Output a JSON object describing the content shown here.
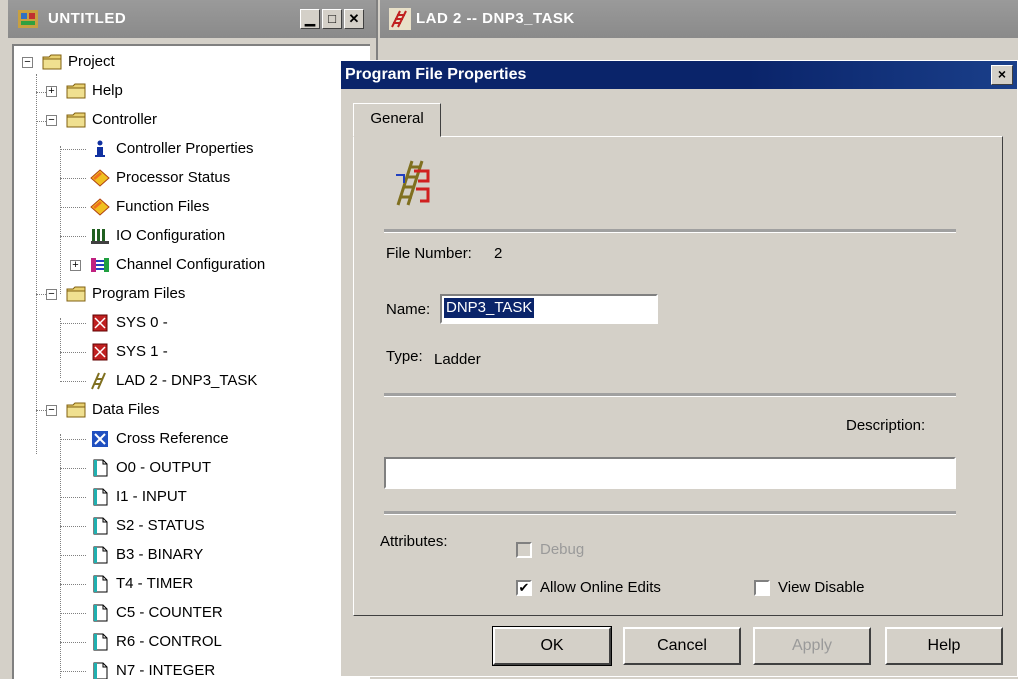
{
  "project_window": {
    "title": "UNTITLED",
    "tree": [
      {
        "key": "project",
        "label": "Project",
        "icon": "folder-icon",
        "level": 0,
        "expander": "minus"
      },
      {
        "key": "help",
        "label": "Help",
        "icon": "folder-icon",
        "level": 1,
        "expander": "plus"
      },
      {
        "key": "controller",
        "label": "Controller",
        "icon": "folder-icon",
        "level": 1,
        "expander": "minus"
      },
      {
        "key": "controller-properties",
        "label": "Controller Properties",
        "icon": "info-icon",
        "level": 2
      },
      {
        "key": "processor-status",
        "label": "Processor Status",
        "icon": "diamond-icon",
        "level": 2
      },
      {
        "key": "function-files",
        "label": "Function Files",
        "icon": "diamond-icon",
        "level": 2
      },
      {
        "key": "io-configuration",
        "label": "IO Configuration",
        "icon": "io-config-icon",
        "level": 2
      },
      {
        "key": "channel-configuration",
        "label": "Channel Configuration",
        "icon": "channel-icon",
        "level": 2,
        "expander": "plus"
      },
      {
        "key": "program-files",
        "label": "Program Files",
        "icon": "folder-icon",
        "level": 1,
        "expander": "minus"
      },
      {
        "key": "sys0",
        "label": "SYS 0 -",
        "icon": "sys-file-icon",
        "level": 2
      },
      {
        "key": "sys1",
        "label": "SYS 1 -",
        "icon": "sys-file-icon",
        "level": 2
      },
      {
        "key": "lad2",
        "label": "LAD 2 - DNP3_TASK",
        "icon": "ladder-icon",
        "level": 2
      },
      {
        "key": "data-files",
        "label": "Data Files",
        "icon": "folder-icon",
        "level": 1,
        "expander": "minus"
      },
      {
        "key": "cross-reference",
        "label": "Cross Reference",
        "icon": "cross-ref-icon",
        "level": 2
      },
      {
        "key": "o0",
        "label": "O0 - OUTPUT",
        "icon": "data-file-icon",
        "level": 2
      },
      {
        "key": "i1",
        "label": "I1 - INPUT",
        "icon": "data-file-icon",
        "level": 2
      },
      {
        "key": "s2",
        "label": "S2 - STATUS",
        "icon": "data-file-icon",
        "level": 2
      },
      {
        "key": "b3",
        "label": "B3 - BINARY",
        "icon": "data-file-icon",
        "level": 2
      },
      {
        "key": "t4",
        "label": "T4 - TIMER",
        "icon": "data-file-icon",
        "level": 2
      },
      {
        "key": "c5",
        "label": "C5 - COUNTER",
        "icon": "data-file-icon",
        "level": 2
      },
      {
        "key": "r6",
        "label": "R6 - CONTROL",
        "icon": "data-file-icon",
        "level": 2
      },
      {
        "key": "n7",
        "label": "N7 - INTEGER",
        "icon": "data-file-icon",
        "level": 2
      }
    ]
  },
  "ladder_window": {
    "title": "LAD 2 -- DNP3_TASK"
  },
  "dialog": {
    "title": "Program File Properties",
    "close_label": "×",
    "tab_general": "General",
    "file_number_label": "File Number:",
    "file_number_value": "2",
    "name_label": "Name:",
    "name_value": "DNP3_TASK",
    "type_label": "Type:",
    "type_value": "Ladder",
    "description_label": "Description:",
    "description_value": "",
    "attributes_label": "Attributes:",
    "debug_label": "Debug",
    "debug_checked": false,
    "allow_online_edits_label": "Allow Online Edits",
    "allow_online_edits_checked": true,
    "view_disable_label": "View Disable",
    "view_disable_checked": false,
    "buttons": {
      "ok": "OK",
      "cancel": "Cancel",
      "apply": "Apply",
      "help": "Help"
    }
  }
}
